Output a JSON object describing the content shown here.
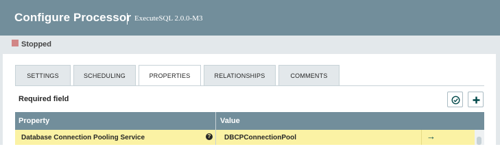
{
  "dialog": {
    "title": "Configure Processor",
    "subtitle": "ExecuteSQL 2.0.0-M3"
  },
  "status": {
    "label": "Stopped",
    "color": "#d18686"
  },
  "tabs": [
    {
      "label": "SETTINGS",
      "active": false
    },
    {
      "label": "SCHEDULING",
      "active": false
    },
    {
      "label": "PROPERTIES",
      "active": true
    },
    {
      "label": "RELATIONSHIPS",
      "active": false
    },
    {
      "label": "COMMENTS",
      "active": false
    }
  ],
  "properties": {
    "required_label": "Required field",
    "toolbar": {
      "verify_icon": "check-circle-icon",
      "add_icon": "plus-icon"
    },
    "columns": {
      "property": "Property",
      "value": "Value"
    },
    "rows": [
      {
        "name": "Database Connection Pooling Service",
        "help_icon": "?",
        "value": "DBCPConnectionPool",
        "action_icon": "→"
      }
    ]
  },
  "colors": {
    "header": "#728e9b",
    "status_bar": "#e3e8eb",
    "row_highlight": "#fbf2a4",
    "accent": "#004849"
  }
}
